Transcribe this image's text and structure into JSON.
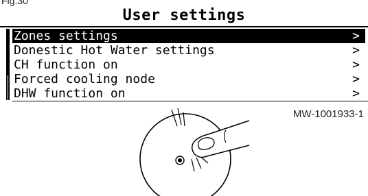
{
  "figure": {
    "label": "Fig.30",
    "reference": "MW-1001933-1"
  },
  "screen": {
    "title": "User settings",
    "menu_items": [
      {
        "label": "Zones settings",
        "chevron": ">",
        "selected": true
      },
      {
        "label": "Donestic Hot Water settings",
        "chevron": ">",
        "selected": false
      },
      {
        "label": "CH function on",
        "chevron": ">",
        "selected": false
      },
      {
        "label": "Forced cooling node",
        "chevron": ">",
        "selected": false
      },
      {
        "label": "DHW function on",
        "chevron": ">",
        "selected": false
      }
    ]
  },
  "illustration": {
    "icon": "rotary-dial-press-icon",
    "action": "press"
  },
  "colors": {
    "foreground": "#000000",
    "background": "#ffffff",
    "selection_text": "#ffffff"
  }
}
